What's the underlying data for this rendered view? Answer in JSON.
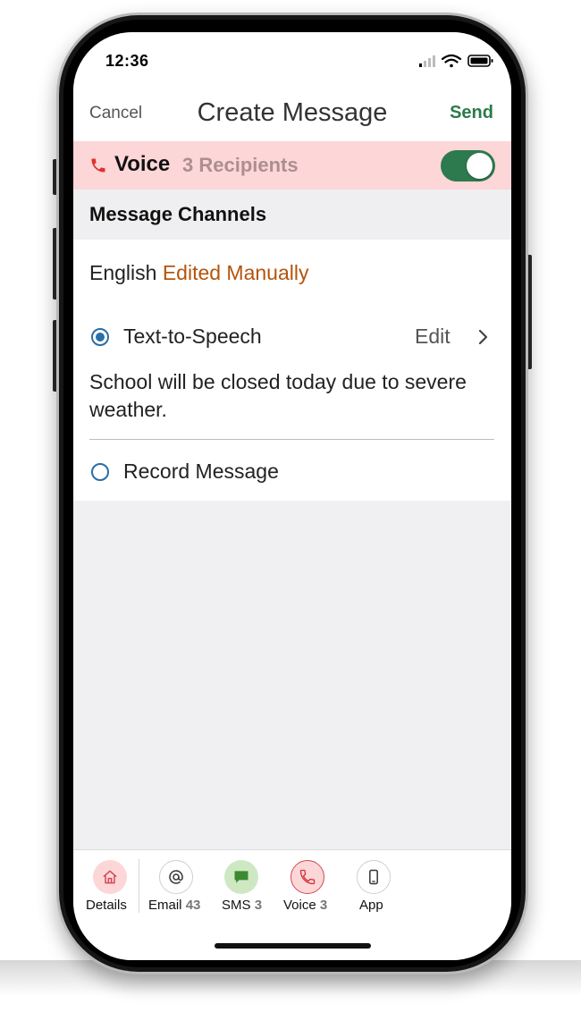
{
  "status_bar": {
    "time": "12:36"
  },
  "nav": {
    "cancel": "Cancel",
    "title": "Create Message",
    "send": "Send"
  },
  "voice_banner": {
    "label": "Voice",
    "recipients": "3 Recipients",
    "enabled": true
  },
  "section": {
    "title": "Message Channels"
  },
  "language": {
    "name": "English",
    "status": "Edited Manually"
  },
  "options": {
    "tts": {
      "label": "Text-to-Speech",
      "selected": true,
      "edit": "Edit"
    },
    "record": {
      "label": "Record Message",
      "selected": false
    }
  },
  "message_text": "School will be closed today due to severe weather.",
  "tabs": [
    {
      "label": "Details",
      "count": "",
      "icon": "home-icon"
    },
    {
      "label": "Email",
      "count": "43",
      "icon": "at-icon"
    },
    {
      "label": "SMS",
      "count": "3",
      "icon": "chat-bubble-icon"
    },
    {
      "label": "Voice",
      "count": "3",
      "icon": "phone-icon"
    },
    {
      "label": "App",
      "count": "",
      "icon": "mobile-device-icon"
    }
  ],
  "colors": {
    "send": "#2c7a4b",
    "voice_banner": "#fdd6d8",
    "toggle_on": "#2d7a4e",
    "edited_status": "#b5540d",
    "radio": "#2a6ea6"
  }
}
